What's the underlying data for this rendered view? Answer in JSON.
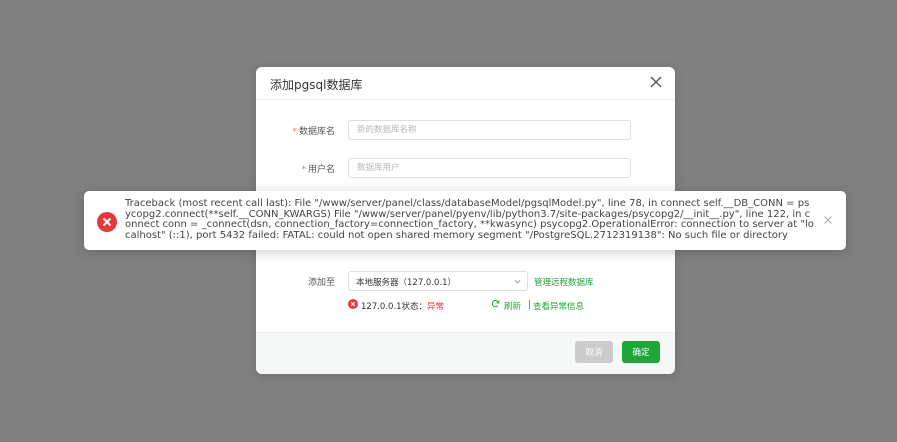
{
  "dialog": {
    "title": "添加pgsql数据库",
    "fields": {
      "db_name": {
        "required_mark": "*",
        "label": "数据库名",
        "placeholder": "新的数据库名称",
        "value": ""
      },
      "user_name": {
        "required_mark": "*",
        "label": "用户名",
        "placeholder": "数据库用户",
        "value": ""
      }
    },
    "add_to": {
      "label": "添加至",
      "selected": "本地服务器（127.0.0.1）",
      "manage_remote_link": "管理远程数据库"
    },
    "status": {
      "server_prefix": "127.0.0.1状态：",
      "state": "异常",
      "refresh_link": "刷新",
      "separator": "|",
      "view_error_link": "查看异常信息"
    },
    "footer": {
      "cancel_label": "取消",
      "confirm_label": "确定"
    }
  },
  "toast": {
    "message": "Traceback (most recent call last): File \"/www/server/panel/class/databaseModel/pgsqlModel.py\", line 78, in connect self.__DB_CONN = psycopg2.connect(**self.__CONN_KWARGS) File \"/www/server/panel/pyenv/lib/python3.7/site-packages/psycopg2/__init__.py\", line 122, in connect conn = _connect(dsn, connection_factory=connection_factory, **kwasync) psycopg2.OperationalError: connection to server at \"localhost\" (::1), port 5432 failed: FATAL: could not open shared memory segment \"/PostgreSQL.2712319138\": No such file or directory"
  },
  "colors": {
    "accent": "#20a53a",
    "error": "#e5383b",
    "overlay": "#808080"
  },
  "icons": {
    "close": "close-icon",
    "error": "error-circle-icon",
    "refresh": "refresh-icon",
    "dropdown": "chevron-down-icon"
  }
}
